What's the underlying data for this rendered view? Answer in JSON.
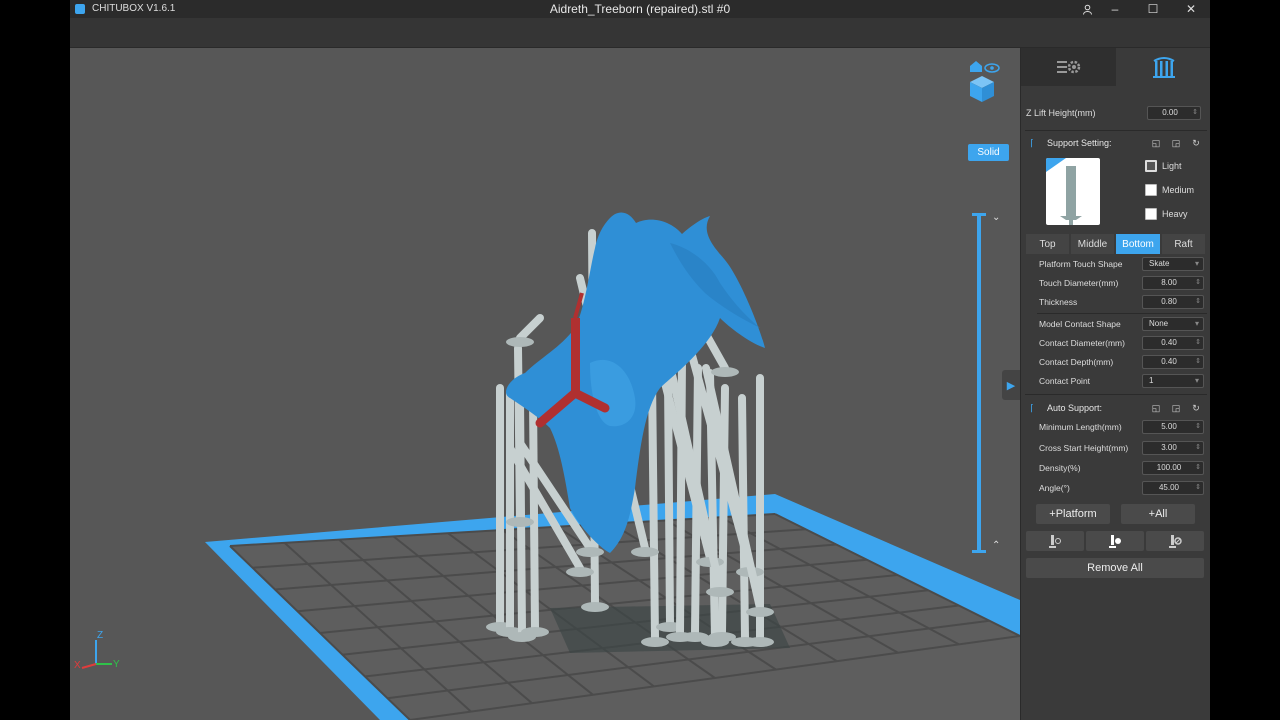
{
  "app": {
    "name": "CHITUBOX V1.6.1",
    "document_title": "Aidreth_Treeborn (repaired).stl #0"
  },
  "window": {
    "user_icon": "user-icon",
    "minimize": "–",
    "maximize": "☐",
    "close": "✕"
  },
  "viewport": {
    "view_mode": "Solid",
    "axes": {
      "x": "X",
      "y": "Y",
      "z": "Z"
    },
    "colors": {
      "model": "#2f8fd6",
      "support": "#c7d0d0",
      "selected_support": "#b03030",
      "platform_border": "#3da5ee",
      "grid": "#4a4a4a",
      "background": "#575757"
    }
  },
  "panel": {
    "tabs": [
      {
        "icon": "settings-icon"
      },
      {
        "icon": "support-icon"
      }
    ],
    "z_lift": {
      "label": "Z Lift Height(mm)",
      "value": "0.00"
    },
    "support_setting": {
      "title": "Support Setting:",
      "presets": [
        {
          "label": "Light",
          "checked": true
        },
        {
          "label": "Medium",
          "checked": false
        },
        {
          "label": "Heavy",
          "checked": false
        }
      ],
      "tabs": [
        {
          "label": "Top",
          "active": false
        },
        {
          "label": "Middle",
          "active": false
        },
        {
          "label": "Bottom",
          "active": true
        },
        {
          "label": "Raft",
          "active": false
        }
      ],
      "fields": [
        {
          "label": "Platform Touch Shape",
          "value": "Skate",
          "type": "select"
        },
        {
          "label": "Touch Diameter(mm)",
          "value": "8.00",
          "type": "number"
        },
        {
          "label": "Thickness",
          "value": "0.80",
          "type": "number"
        },
        {
          "label": "Model Contact Shape",
          "value": "None",
          "type": "select"
        },
        {
          "label": "Contact Diameter(mm)",
          "value": "0.40",
          "type": "number"
        },
        {
          "label": "Contact Depth(mm)",
          "value": "0.40",
          "type": "number"
        },
        {
          "label": "Contact Point",
          "value": "1",
          "type": "select"
        }
      ]
    },
    "auto_support": {
      "title": "Auto Support:",
      "fields": [
        {
          "label": "Minimum Length(mm)",
          "value": "5.00"
        },
        {
          "label": "Cross Start Height(mm)",
          "value": "3.00"
        },
        {
          "label": "Density(%)",
          "value": "100.00"
        },
        {
          "label": "Angle(°)",
          "value": "45.00"
        }
      ],
      "platform_button": "+Platform",
      "all_button": "+All",
      "remove_all": "Remove All"
    }
  }
}
